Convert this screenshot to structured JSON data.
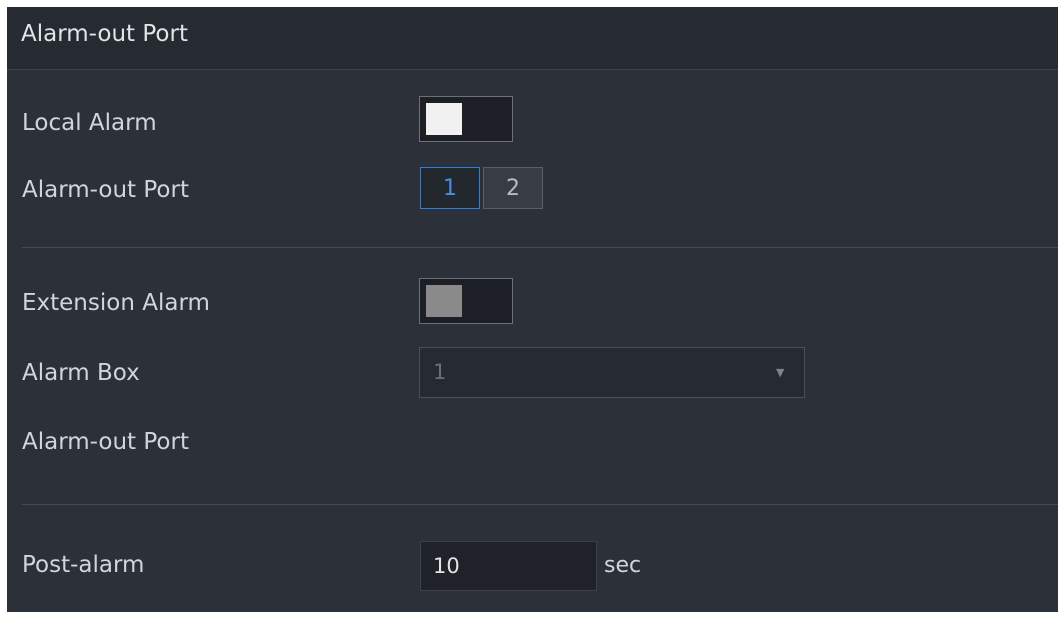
{
  "header": {
    "title": "Alarm-out Port"
  },
  "local_alarm": {
    "label": "Local Alarm",
    "enabled": true,
    "port_label": "Alarm-out Port",
    "ports": [
      {
        "label": "1",
        "selected": true
      },
      {
        "label": "2",
        "selected": false
      }
    ]
  },
  "extension_alarm": {
    "label": "Extension Alarm",
    "enabled": false,
    "alarm_box_label": "Alarm Box",
    "alarm_box_value": "1",
    "port_label": "Alarm-out Port"
  },
  "post_alarm": {
    "label": "Post-alarm",
    "value": "10",
    "unit": "sec"
  },
  "icons": {
    "dropdown": "caret-down-icon"
  },
  "colors": {
    "panel_bg": "#2c3038",
    "header_bg": "#262a31",
    "accent_blue": "#2f7ed8",
    "text": "#d2d5da"
  }
}
